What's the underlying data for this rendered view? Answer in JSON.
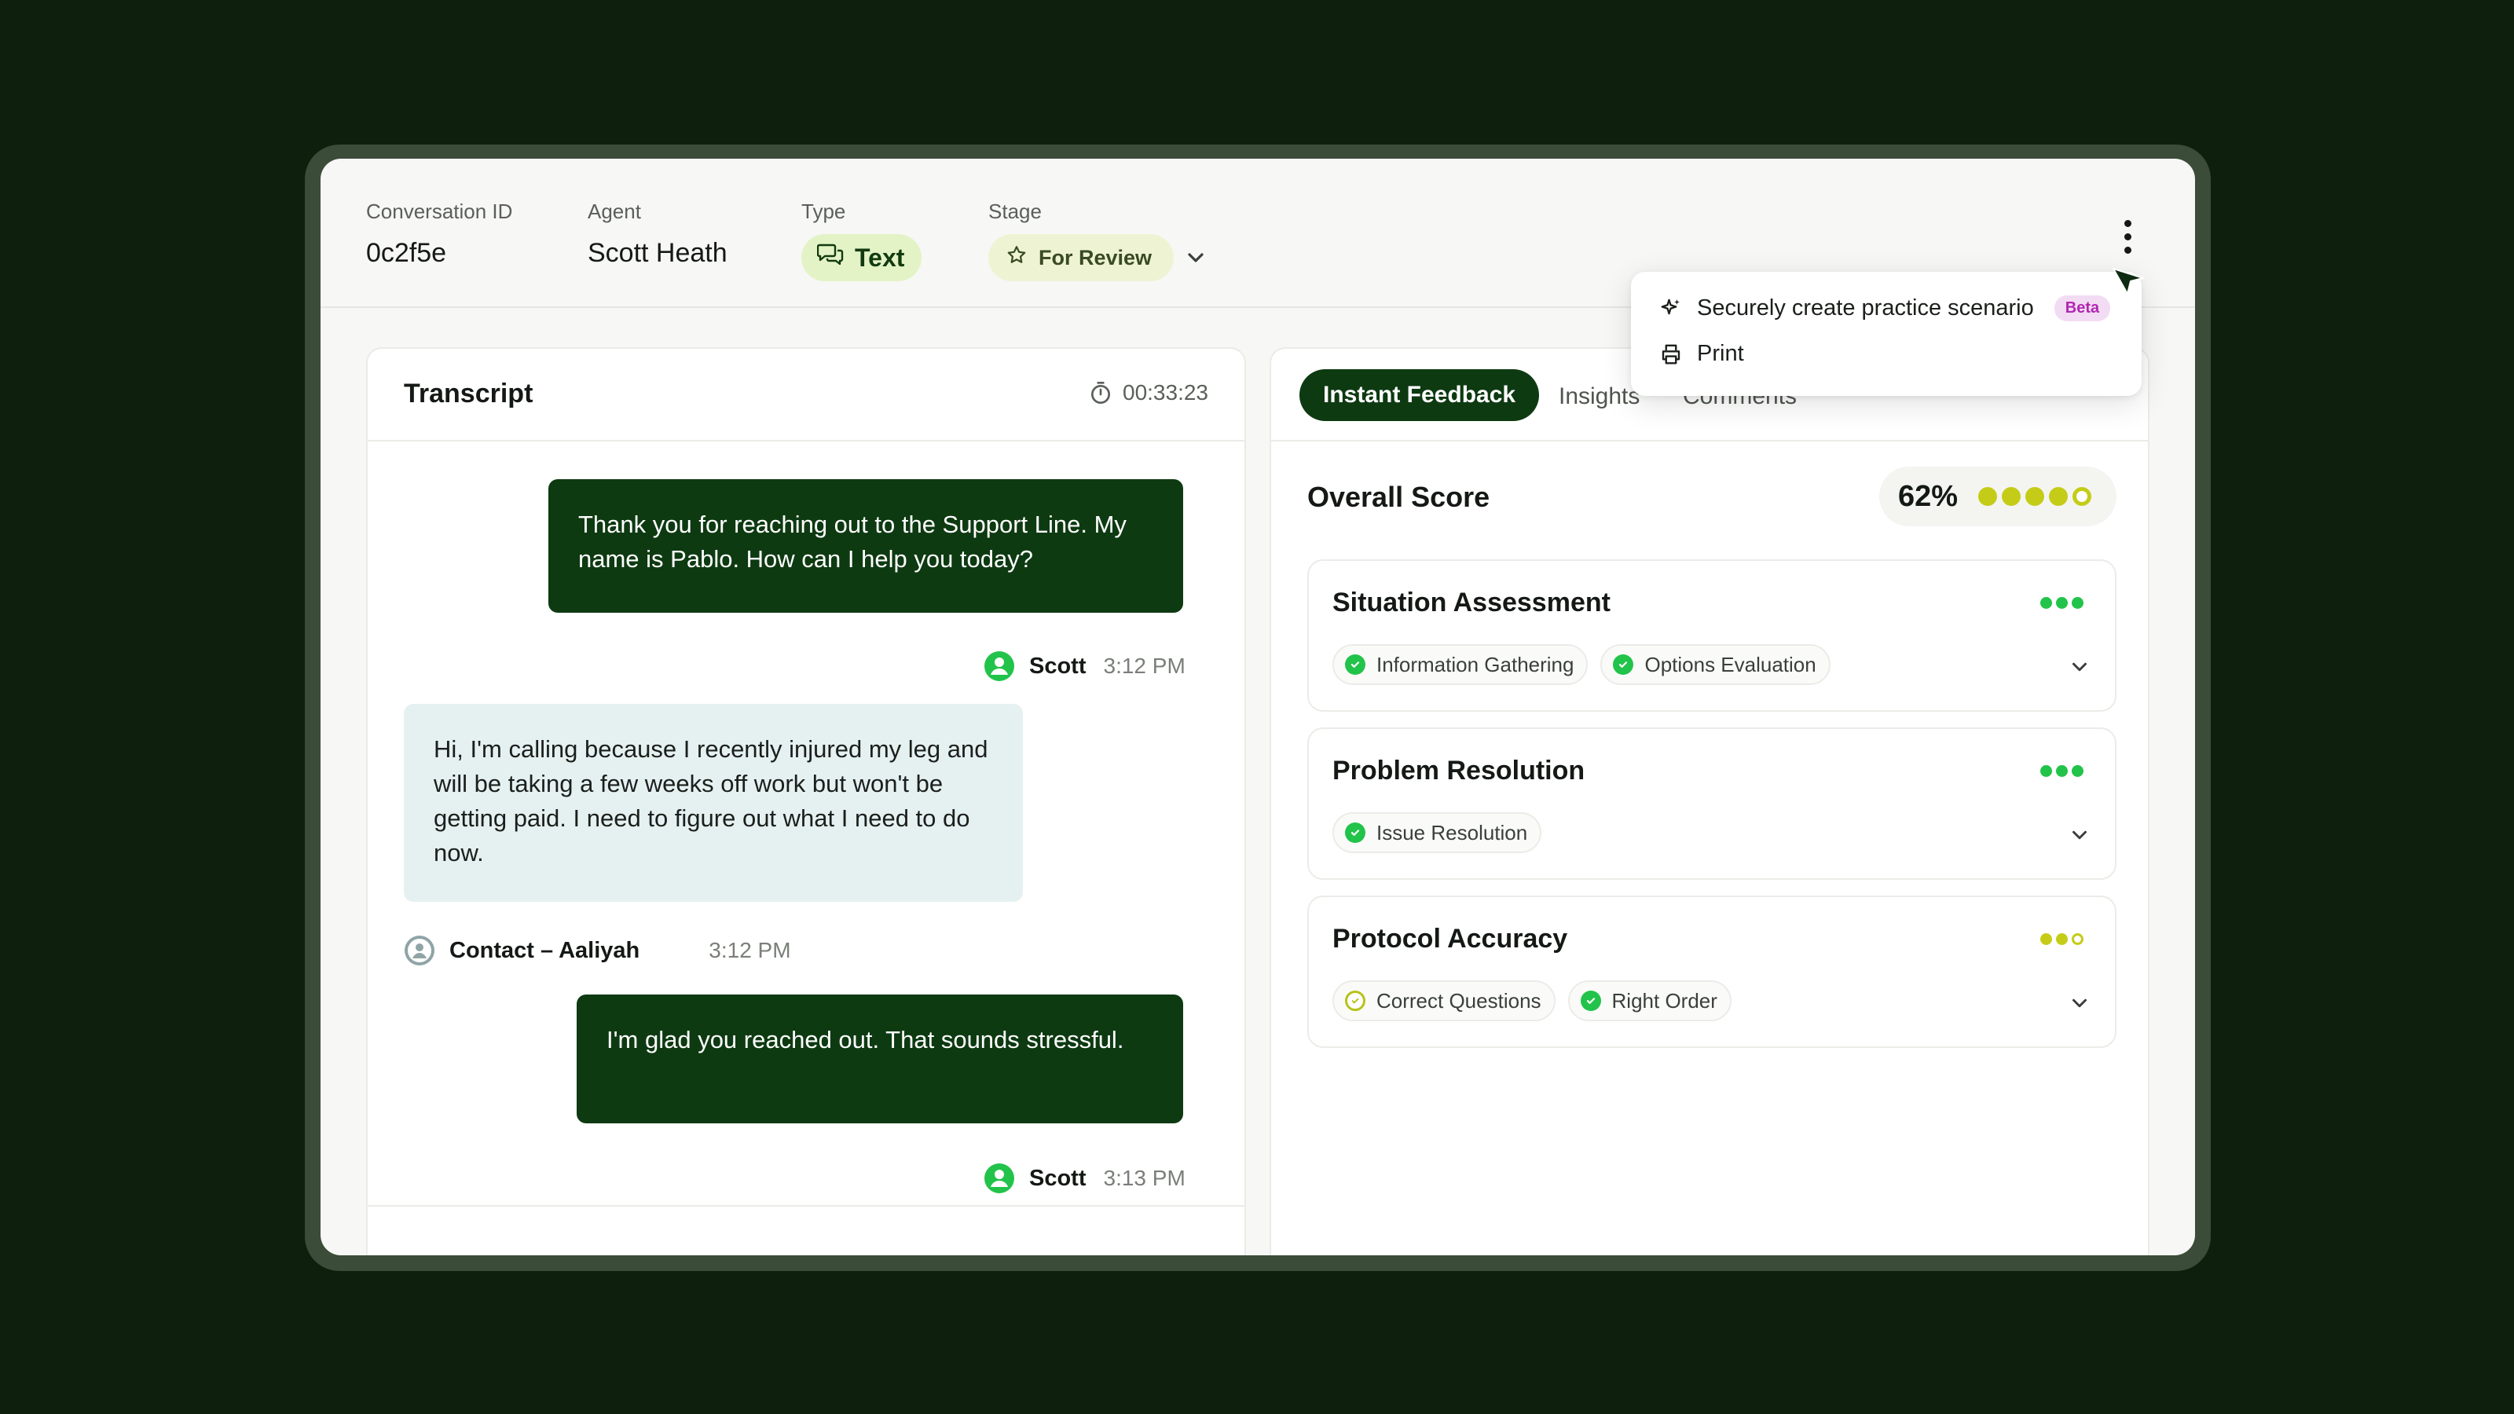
{
  "header": {
    "conversation_id_label": "Conversation ID",
    "conversation_id": "0c2f5e",
    "agent_label": "Agent",
    "agent": "Scott Heath",
    "type_label": "Type",
    "type": "Text",
    "stage_label": "Stage",
    "stage": "For Review"
  },
  "menu": {
    "items": [
      {
        "label": "Securely create practice scenario",
        "badge": "Beta",
        "icon": "sparkle-icon"
      },
      {
        "label": "Print",
        "icon": "printer-icon"
      }
    ]
  },
  "transcript": {
    "title": "Transcript",
    "duration": "00:33:23",
    "messages": [
      {
        "role": "agent",
        "text": "Thank you for reaching out to the Support Line. My name is Pablo. How can I help you today?",
        "sender": "Scott",
        "time": "3:12 PM"
      },
      {
        "role": "contact",
        "text": "Hi, I'm calling because I recently injured my leg and will be taking a few weeks off work but won't be getting paid. I need to figure out what I need to do now.",
        "sender": "Contact – Aaliyah",
        "time": "3:12 PM"
      },
      {
        "role": "agent",
        "text": "I'm glad you reached out. That sounds stressful.",
        "sender": "Scott",
        "time": "3:13 PM"
      }
    ]
  },
  "feedback": {
    "tabs": [
      "Instant Feedback",
      "Insights",
      "Comments"
    ],
    "active_tab": "Instant Feedback",
    "overall_label": "Overall Score",
    "overall_score": "62%",
    "overall_rating": {
      "filled": 4,
      "total": 5
    },
    "categories": [
      {
        "title": "Situation Assessment",
        "rating": {
          "filled": 3,
          "total": 3
        },
        "color": "#22c34a",
        "tags": [
          {
            "label": "Information Gathering",
            "status": "pass"
          },
          {
            "label": "Options Evaluation",
            "status": "pass"
          }
        ]
      },
      {
        "title": "Problem Resolution",
        "rating": {
          "filled": 3,
          "total": 3
        },
        "color": "#22c34a",
        "tags": [
          {
            "label": "Issue Resolution",
            "status": "pass"
          }
        ]
      },
      {
        "title": "Protocol Accuracy",
        "rating": {
          "filled": 2,
          "total": 3
        },
        "color": "#c5cc18",
        "tags": [
          {
            "label": "Correct Questions",
            "status": "partial"
          },
          {
            "label": "Right Order",
            "status": "pass"
          }
        ]
      }
    ]
  },
  "colors": {
    "background": "#0e1f0e",
    "agent_bubble": "#0e3a12",
    "contact_bubble": "#e5f1f1",
    "success": "#22c34a",
    "rating_yellow": "#c5cc18",
    "beta": "#b128b3"
  }
}
